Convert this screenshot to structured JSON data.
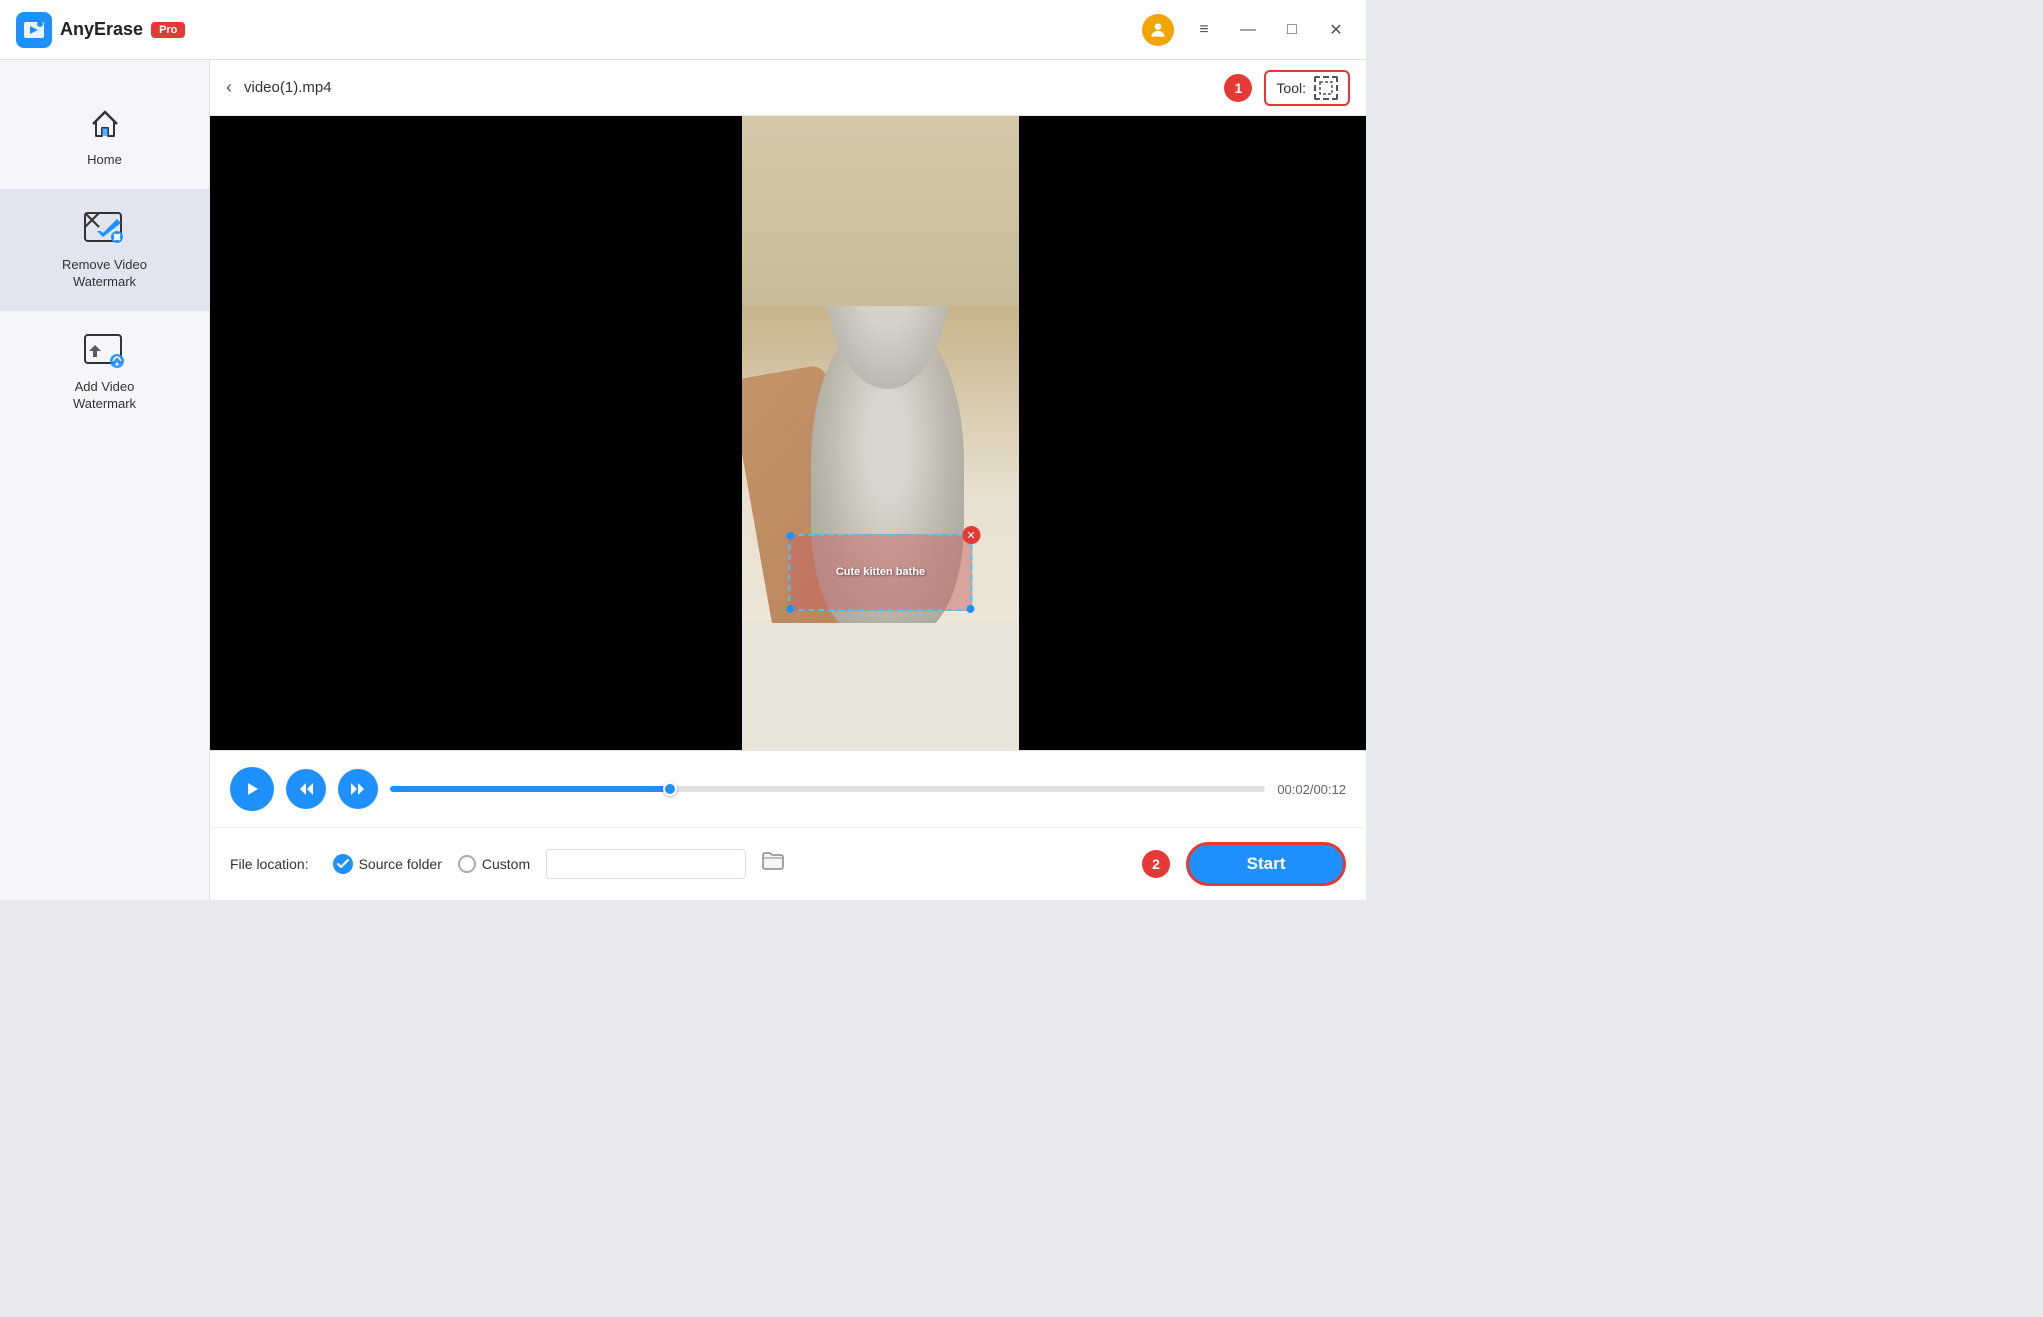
{
  "titleBar": {
    "appName": "AnyErase",
    "proBadge": "Pro",
    "windowControls": {
      "menu": "≡",
      "minimize": "—",
      "maximize": "□",
      "close": "✕"
    }
  },
  "sidebar": {
    "items": [
      {
        "id": "home",
        "label": "Home",
        "icon": "home-icon"
      },
      {
        "id": "remove-video-watermark",
        "label": "Remove Video\nWatermark",
        "icon": "remove-watermark-icon",
        "active": true
      },
      {
        "id": "add-video-watermark",
        "label": "Add Video\nWatermark",
        "icon": "add-watermark-icon"
      }
    ]
  },
  "videoHeader": {
    "filename": "video(1).mp4",
    "step1Badge": "1",
    "toolLabel": "Tool:"
  },
  "videoPlayer": {
    "watermarkText": "Cute kitten bathe"
  },
  "controls": {
    "currentTime": "00:02",
    "totalTime": "00:12",
    "timeDisplay": "00:02/00:12",
    "progressPercent": 32
  },
  "fileLocation": {
    "label": "File location:",
    "sourceFolder": {
      "label": "Source folder",
      "selected": true
    },
    "custom": {
      "label": "Custom",
      "selected": false,
      "placeholder": ""
    },
    "step2Badge": "2",
    "startButton": "Start"
  }
}
